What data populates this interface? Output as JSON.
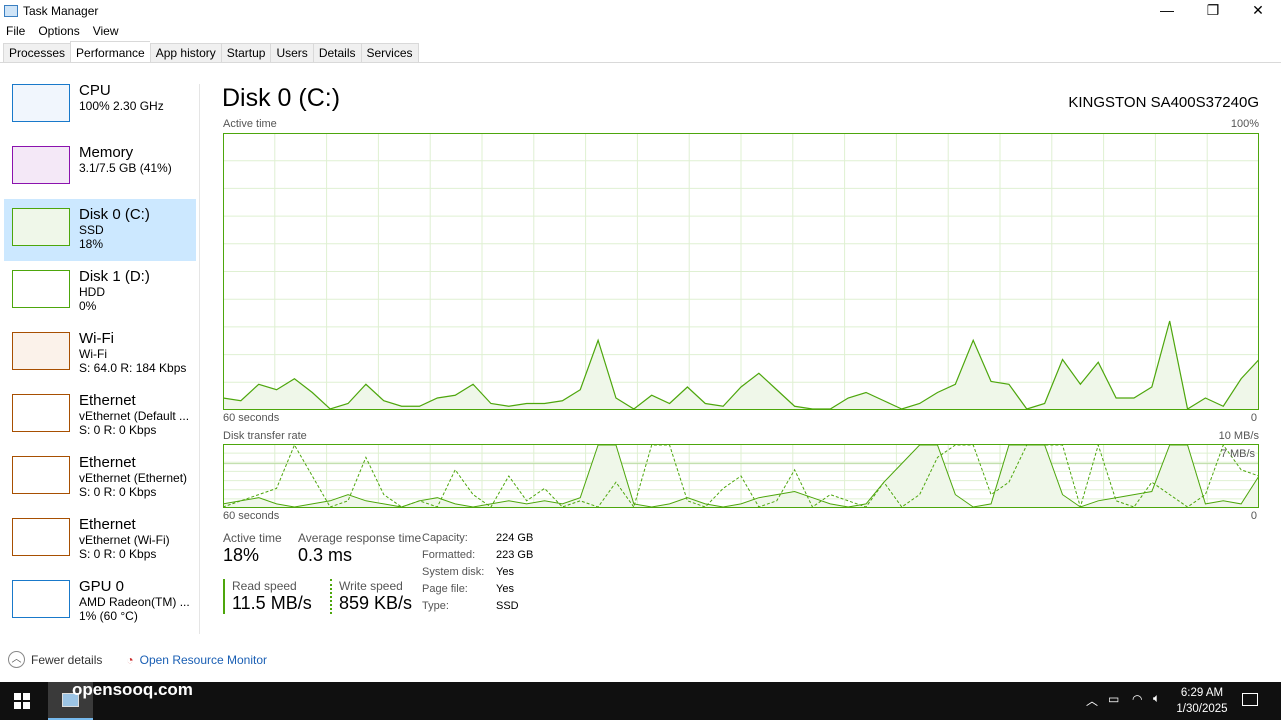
{
  "window": {
    "title": "Task Manager",
    "minimize": "—",
    "maximize": "❐",
    "close": "✕"
  },
  "menu": [
    "File",
    "Options",
    "View"
  ],
  "tabs": [
    "Processes",
    "Performance",
    "App history",
    "Startup",
    "Users",
    "Details",
    "Services"
  ],
  "active_tab": "Performance",
  "sidebar": [
    {
      "name": "CPU",
      "l1": "100% 2.30 GHz",
      "l2": "",
      "color": "#1979ca"
    },
    {
      "name": "Memory",
      "l1": "3.1/7.5 GB (41%)",
      "l2": "",
      "color": "#8b12ae"
    },
    {
      "name": "Disk 0 (C:)",
      "l1": "SSD",
      "l2": "18%",
      "color": "#4da60c"
    },
    {
      "name": "Disk 1 (D:)",
      "l1": "HDD",
      "l2": "0%",
      "color": "#4da60c"
    },
    {
      "name": "Wi-Fi",
      "l1": "Wi-Fi",
      "l2": "S: 64.0  R: 184 Kbps",
      "color": "#a74f01"
    },
    {
      "name": "Ethernet",
      "l1": "vEthernet (Default ...",
      "l2": "S: 0  R: 0 Kbps",
      "color": "#a74f01"
    },
    {
      "name": "Ethernet",
      "l1": "vEthernet (Ethernet)",
      "l2": "S: 0  R: 0 Kbps",
      "color": "#a74f01"
    },
    {
      "name": "Ethernet",
      "l1": "vEthernet (Wi-Fi)",
      "l2": "S: 0  R: 0 Kbps",
      "color": "#a74f01"
    },
    {
      "name": "GPU 0",
      "l1": "AMD Radeon(TM) ...",
      "l2": "1% (60 °C)",
      "color": "#1979ca"
    }
  ],
  "main": {
    "title": "Disk 0 (C:)",
    "model": "KINGSTON SA400S37240G",
    "chart1_label": "Active time",
    "chart1_max": "100%",
    "chart1_xleft": "60 seconds",
    "chart1_xright": "0",
    "chart2_label": "Disk transfer rate",
    "chart2_max": "10 MB/s",
    "chart2_mid": "7 MB/s",
    "chart2_xleft": "60 seconds",
    "chart2_xright": "0",
    "stats": {
      "active_time_label": "Active time",
      "active_time": "18%",
      "resp_label": "Average response time",
      "resp": "0.3 ms",
      "read_label": "Read speed",
      "read": "11.5 MB/s",
      "write_label": "Write speed",
      "write": "859 KB/s"
    },
    "props": [
      [
        "Capacity:",
        "224 GB"
      ],
      [
        "Formatted:",
        "223 GB"
      ],
      [
        "System disk:",
        "Yes"
      ],
      [
        "Page file:",
        "Yes"
      ],
      [
        "Type:",
        "SSD"
      ]
    ]
  },
  "footer": {
    "fewer_details": "Fewer details",
    "resource_monitor": "Open Resource Monitor"
  },
  "watermark": "opensooq.com",
  "taskbar": {
    "time": "6:29 AM",
    "date": "1/30/2025"
  },
  "colors": {
    "disk": "#4da60c",
    "disk_fill": "#eff7e9",
    "grid": "#dff0d2"
  },
  "chart_data": [
    {
      "type": "area",
      "title": "Active time",
      "ylim": [
        0,
        100
      ],
      "xlim": [
        60,
        0
      ],
      "xlabel": "60 seconds",
      "y_unit": "%",
      "values": [
        4,
        3,
        9,
        7,
        11,
        6,
        0,
        2,
        9,
        3,
        1,
        1,
        4,
        5,
        9,
        2,
        1,
        2,
        2,
        3,
        7,
        25,
        4,
        0,
        5,
        2,
        8,
        2,
        1,
        8,
        13,
        7,
        1,
        0,
        0,
        4,
        6,
        3,
        0,
        2,
        6,
        9,
        25,
        10,
        9,
        0,
        2,
        18,
        9,
        17,
        4,
        4,
        8,
        32,
        0,
        4,
        1,
        11,
        18
      ]
    },
    {
      "type": "line",
      "title": "Disk transfer rate",
      "ylim": [
        0,
        10
      ],
      "xlim": [
        60,
        0
      ],
      "y_unit": "MB/s",
      "reference_line": 7,
      "series": [
        {
          "style": "solid",
          "values": [
            0.5,
            1,
            1.5,
            0.5,
            0,
            0.5,
            1,
            2,
            1,
            0.5,
            0,
            1,
            1.5,
            0.5,
            0,
            0.5,
            1,
            0.5,
            1,
            0.5,
            1.5,
            10,
            10,
            0.5,
            0,
            0.5,
            1.5,
            0.5,
            0,
            0.5,
            1.5,
            2,
            2.5,
            1.5,
            0.5,
            0,
            0.5,
            4,
            7,
            10,
            10,
            2,
            0,
            0.5,
            10,
            10,
            10,
            2,
            0,
            1,
            1.5,
            2,
            2.5,
            10,
            10,
            0.5,
            1,
            0.5,
            5
          ]
        },
        {
          "style": "dashed",
          "values": [
            0,
            1,
            2,
            3,
            10,
            5,
            0,
            1,
            8,
            2,
            0,
            1,
            0,
            6,
            2,
            0,
            5,
            1,
            3,
            0,
            1,
            0,
            4,
            0,
            10,
            10,
            1,
            0,
            3,
            5,
            0,
            1,
            6,
            0,
            2,
            1,
            0,
            4,
            0,
            2,
            8,
            10,
            10,
            2,
            4,
            10,
            10,
            10,
            0,
            10,
            1,
            0,
            4,
            2,
            0,
            2,
            10,
            6,
            5
          ]
        }
      ]
    }
  ]
}
